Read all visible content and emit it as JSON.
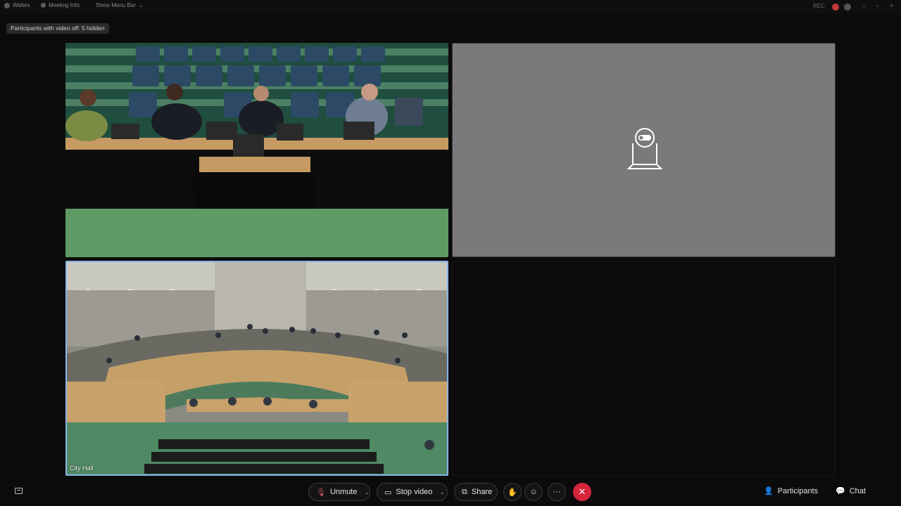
{
  "titlebar": {
    "app_name": "Webex",
    "meeting_info": "Meeting Info",
    "show_menu": "Show Menu Bar",
    "status": "REC"
  },
  "hidden_badge": "Participants with video off: 5 hidden",
  "tiles": {
    "bottom_left_label": "City Hall"
  },
  "controls": {
    "unmute": "Unmute",
    "stop_video": "Stop video",
    "share": "Share",
    "participants": "Participants",
    "chat": "Chat"
  },
  "colors": {
    "end_call": "#d6243a",
    "active_speaker_border": "#8ab4e8",
    "camera_off_tile": "#7a7a7a"
  }
}
